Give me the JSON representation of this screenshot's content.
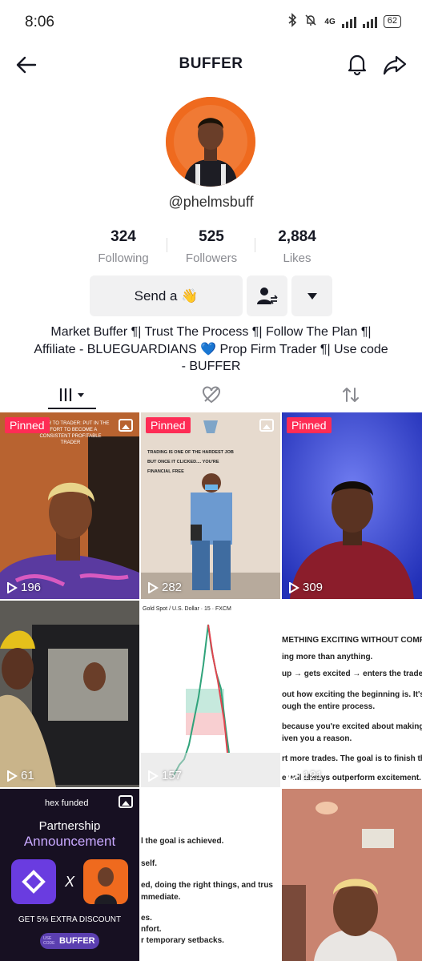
{
  "status_bar": {
    "time": "8:06",
    "network": "4G",
    "battery": "62"
  },
  "header": {
    "title": "BUFFER"
  },
  "profile": {
    "username": "@phelmsbuff"
  },
  "stats": [
    {
      "value": "324",
      "label": "Following"
    },
    {
      "value": "525",
      "label": "Followers"
    },
    {
      "value": "2,884",
      "label": "Likes"
    }
  ],
  "actions": {
    "send_label": "Send a 👋"
  },
  "bio": "Market Buffer ¶| Trust The Process ¶| Follow The Plan ¶| Affiliate - BLUEGUARDIANS 💙 Prop Firm Trader ¶| Use code - BUFFER",
  "videos": [
    {
      "pinned_label": "Pinned",
      "views": "196",
      "overlay": "TRADER TO TRADER: PUT IN THE EFFORT TO BECOME A CONSISTENT PROFITABLE TRADER"
    },
    {
      "pinned_label": "Pinned",
      "views": "282",
      "overlay": "TRADING IS ONE OF THE HARDEST JOB BUT ONCE IT CLICKED.... YOU'RE FINANCIAL FREE"
    },
    {
      "pinned_label": "Pinned",
      "views": "309"
    },
    {
      "views": "61"
    },
    {
      "views": "157",
      "chart_label": "Gold Spot / U.S. Dollar · 15 · FXCM"
    },
    {
      "views": "121",
      "lines": [
        "METHING EXCITING WITHOUT COMPLETING",
        "ing more than anything.",
        "up → gets excited → enters the trade → start",
        "out how exciting the beginning is. It's about w",
        "ough the entire process.",
        "because you're excited about making money",
        "iven you a reason.",
        "rt more trades. The goal is to finish the proce",
        "e will always outperform excitement."
      ]
    },
    {
      "brand": "hex funded",
      "title_line1": "Partnership",
      "title_line2": "Announcement",
      "cross": "X",
      "discount": "GET 5% EXTRA DISCOUNT",
      "code_prefix": "USE CODE",
      "code": "BUFFER"
    },
    {
      "lines": [
        "l the goal is achieved.",
        "self.",
        "ed, doing the right things, and trus",
        "mmediate.",
        "es.",
        "nfort.",
        "r temporary setbacks."
      ]
    },
    {}
  ],
  "colors": {
    "accent": "#fe2c55",
    "avatar_ring": "#ef6a1e",
    "button_bg": "#f1f1f2"
  }
}
